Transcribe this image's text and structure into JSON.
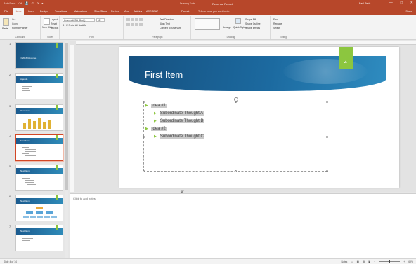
{
  "titlebar": {
    "quick_access": [
      "AutoSave",
      "Off",
      "💾",
      "↶",
      "↷",
      "▾"
    ],
    "context_label": "Drawing Tools",
    "title": "Revenue Report",
    "user": "Paul Reda",
    "window_buttons": [
      "—",
      "□",
      "✕"
    ]
  },
  "tabs": [
    "File",
    "Home",
    "Insert",
    "Design",
    "Transitions",
    "Animations",
    "Slide Show",
    "Review",
    "View",
    "Add-ins",
    "ACROBAT",
    "Format"
  ],
  "active_tab": "Home",
  "tell_me": "Tell me what you want to do",
  "share": "Share",
  "ribbon": {
    "groups": [
      "Clipboard",
      "Slides",
      "Font",
      "Paragraph",
      "Drawing",
      "Editing"
    ],
    "clipboard": {
      "paste": "Paste",
      "cut": "Cut",
      "copy": "Copy",
      "format_painter": "Format Painter"
    },
    "slides": {
      "new_slide": "New Slide",
      "layout": "Layout",
      "reset": "Reset",
      "section": "Section"
    },
    "font": {
      "name": "Univers Lt Std (Body)",
      "size": "18+",
      "row2": "B  I  U  S  abc  AV  Aa  A  A"
    },
    "paragraph": {
      "text_direction": "Text Direction",
      "align_text": "Align Text",
      "convert": "Convert to SmartArt"
    },
    "drawing": {
      "arrange": "Arrange",
      "quick_styles": "Quick Styles",
      "fill": "Shape Fill",
      "outline": "Shape Outline",
      "effects": "Shape Effects"
    },
    "editing": {
      "find": "Find",
      "replace": "Replace",
      "select": "Select"
    }
  },
  "thumbnails": [
    {
      "num": "1",
      "label": "FY2016 Revenue"
    },
    {
      "num": "2",
      "label": "Agenda"
    },
    {
      "num": "3",
      "label": "Overview"
    },
    {
      "num": "4",
      "label": "First Item"
    },
    {
      "num": "5",
      "label": "Next Item"
    },
    {
      "num": "6",
      "label": "Next Item"
    },
    {
      "num": "7",
      "label": "Next Item"
    }
  ],
  "slide": {
    "title": "First Item",
    "number": "4",
    "bullets": [
      {
        "text": "Idea #1",
        "level": 1
      },
      {
        "text": "Subordinate Thought A",
        "level": 2
      },
      {
        "text": "Subordinate Thought B",
        "level": 2
      },
      {
        "text": "Idea #2",
        "level": 1
      },
      {
        "text": "Subordinate Thought C",
        "level": 2
      }
    ]
  },
  "notes_placeholder": "Click to add notes",
  "status": {
    "slide_of": "Slide 4 of 14",
    "notes_btn": "Notes",
    "zoom": "69%"
  },
  "colors": {
    "accent": "#b7472a",
    "brand_green": "#8cc63f",
    "banner_blue": "#1c6aa0"
  }
}
